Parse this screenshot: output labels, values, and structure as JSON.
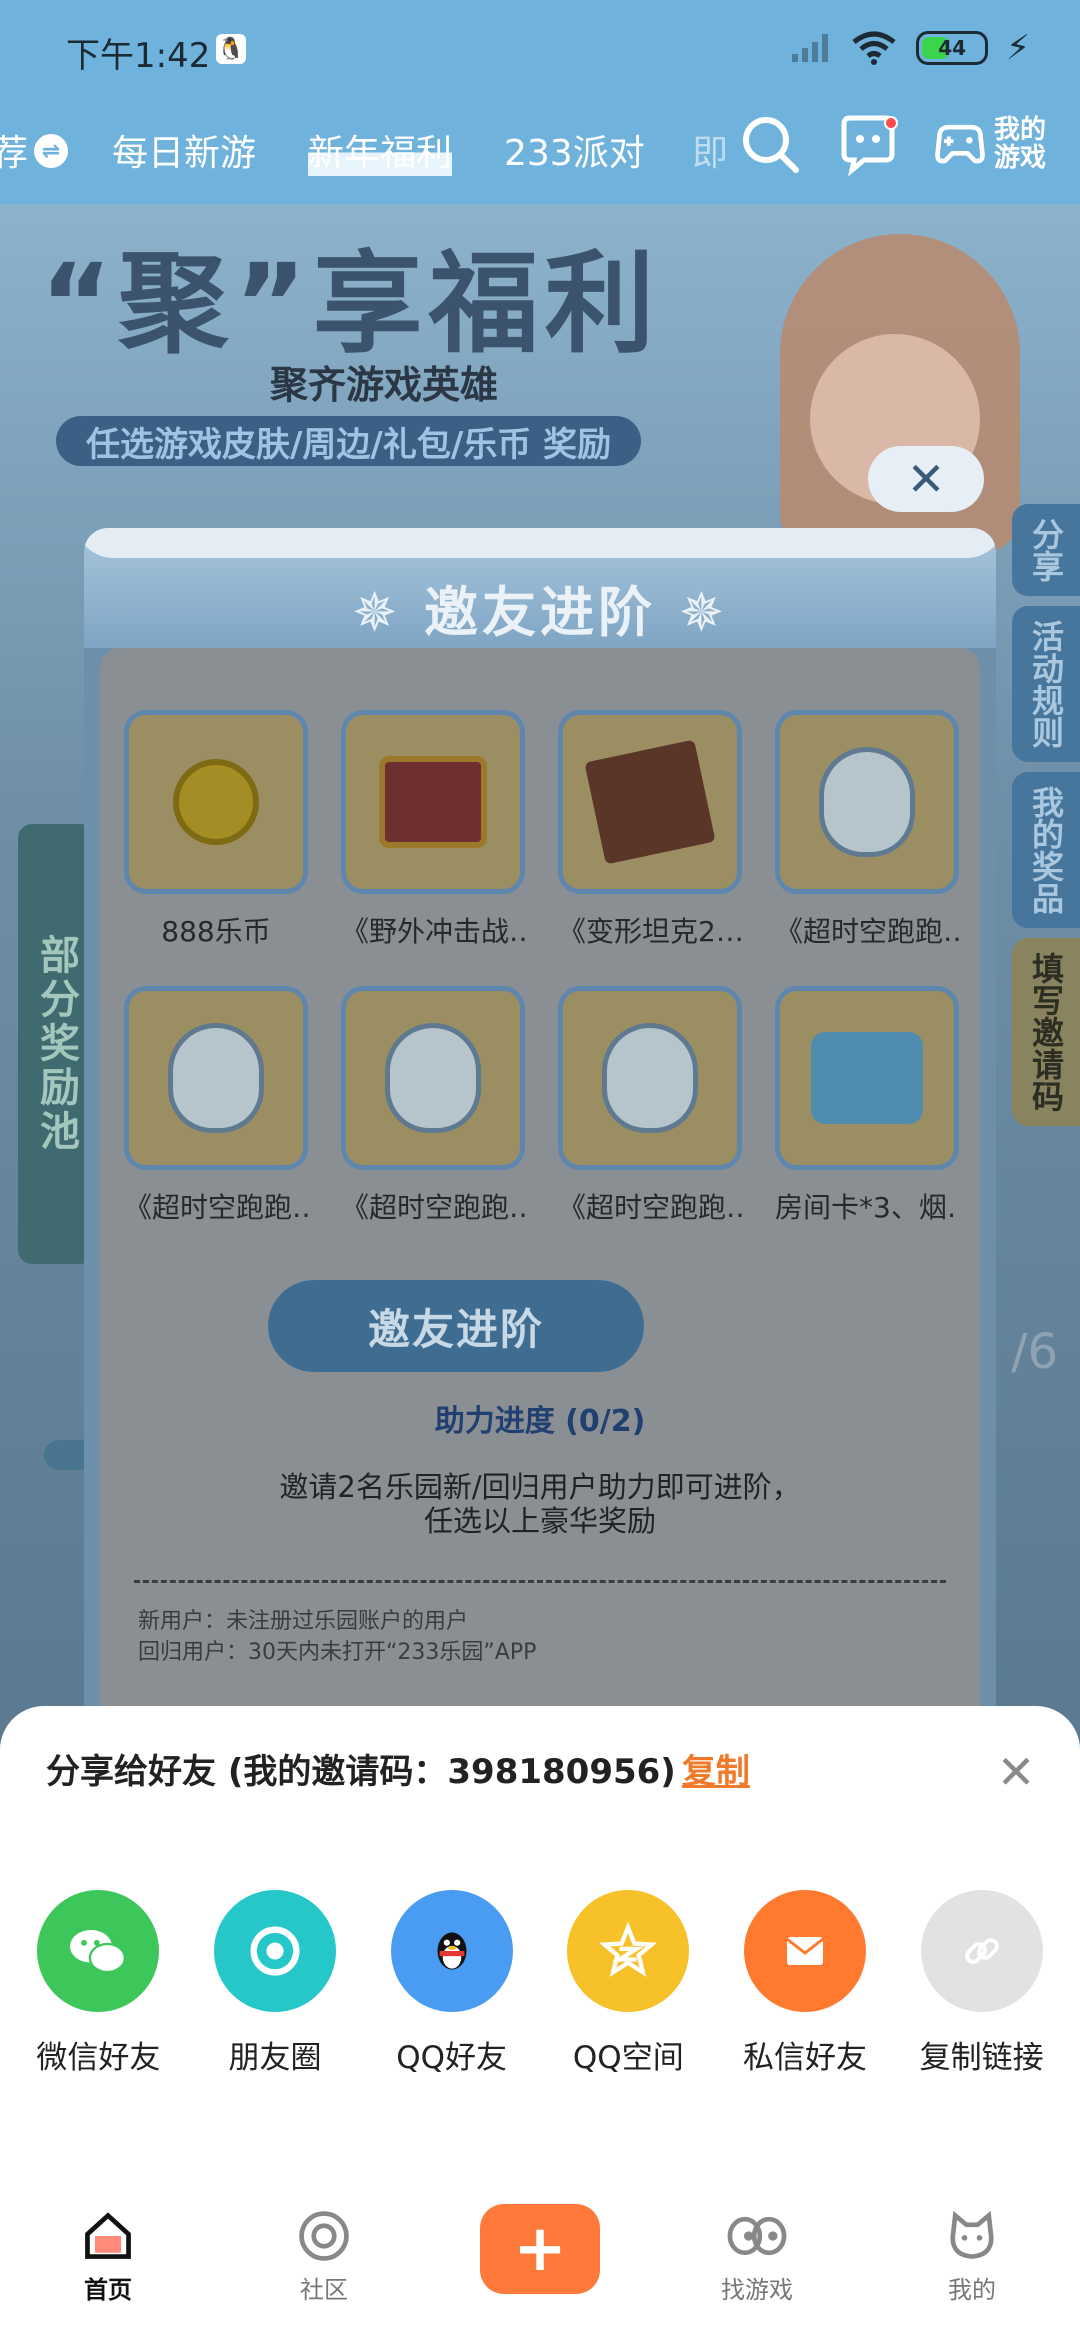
{
  "status_bar": {
    "time": "下午1:42",
    "battery": "44"
  },
  "top_nav": {
    "tabs": [
      {
        "label": "荐"
      },
      {
        "label": "每日新游"
      },
      {
        "label": "新年福利"
      },
      {
        "label": "233派对"
      },
      {
        "label": "即"
      }
    ],
    "my_games_label": "我的游戏"
  },
  "background": {
    "banner_title": "“聚”享福利",
    "banner_subtitle": "聚齐游戏英雄",
    "banner_tagline": "任选游戏皮肤/周边/礼包/乐币 奖励",
    "side_pool": "部分奖励池",
    "side_tabs": [
      "分享",
      "活动规则",
      "我的奖品",
      "填写邀请码"
    ],
    "fraction": "/6"
  },
  "modal": {
    "title": "邀友进阶",
    "prizes": [
      {
        "name": "888乐币",
        "icon": "coin-icon"
      },
      {
        "name": "《野外冲击战…",
        "icon": "treasure-chest-icon"
      },
      {
        "name": "《变形坦克2…",
        "icon": "gift-box-icon"
      },
      {
        "name": "《超时空跑跑…",
        "icon": "book-egg-icon"
      },
      {
        "name": "《超时空跑跑…",
        "icon": "candy-egg-icon"
      },
      {
        "name": "《超时空跑跑…",
        "icon": "cape-egg-icon"
      },
      {
        "name": "《超时空跑跑…",
        "icon": "bottle-egg-icon"
      },
      {
        "name": "房间卡*3、烟…",
        "icon": "blue-chest-icon"
      }
    ],
    "invite_button": "邀友进阶",
    "progress_text": "助力进度 (0/2)",
    "description_line1": "邀请2名乐园新/回归用户助力即可进阶，",
    "description_line2": "任选以上豪华奖励",
    "note_line1": "新用户：未注册过乐园账户的用户",
    "note_line2": "回归用户：30天内未打开“233乐园”APP"
  },
  "share_sheet": {
    "title": "分享给好友 (我的邀请码：398180956)",
    "copy_label": "复制",
    "options": [
      {
        "label": "微信好友",
        "icon": "wechat-icon",
        "color": "#3dc65a"
      },
      {
        "label": "朋友圈",
        "icon": "moments-icon",
        "color": "#25c7c9"
      },
      {
        "label": "QQ好友",
        "icon": "qq-icon",
        "color": "#4a9cf2"
      },
      {
        "label": "QQ空间",
        "icon": "qzone-icon",
        "color": "#f7c12a"
      },
      {
        "label": "私信好友",
        "icon": "mail-icon",
        "color": "#ff7a2e"
      },
      {
        "label": "复制链接",
        "icon": "link-icon",
        "color": "#e2e2e2"
      }
    ]
  },
  "bottom_tabs": [
    {
      "label": "首页",
      "icon": "home-icon"
    },
    {
      "label": "社区",
      "icon": "community-icon"
    },
    {
      "label": "+",
      "icon": "plus-icon"
    },
    {
      "label": "找游戏",
      "icon": "find-games-icon"
    },
    {
      "label": "我的",
      "icon": "profile-icon"
    }
  ],
  "colors": {
    "header": "#6fb3dd",
    "accent_orange": "#ff7a3a",
    "copy_link": "#f07a2a"
  }
}
